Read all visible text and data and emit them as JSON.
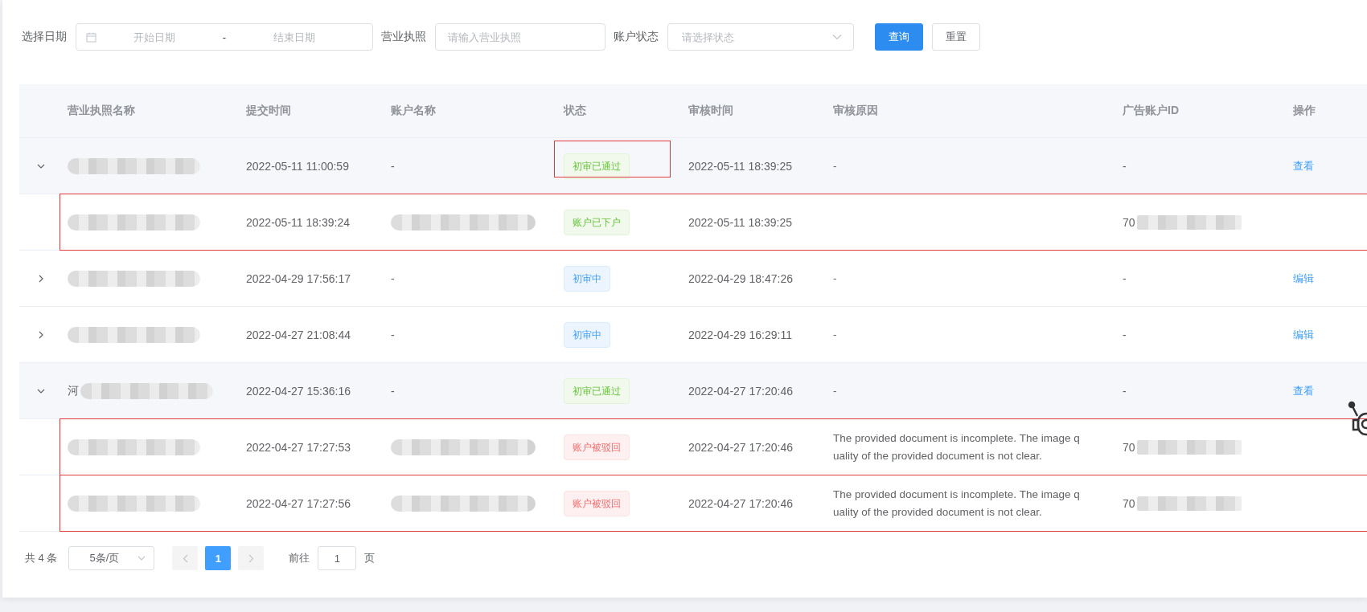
{
  "filters": {
    "date_label": "选择日期",
    "date_start_placeholder": "开始日期",
    "date_separator": "-",
    "date_end_placeholder": "结束日期",
    "license_label": "营业执照",
    "license_placeholder": "请输入营业执照",
    "status_label": "账户状态",
    "status_placeholder": "请选择状态",
    "query_button": "查询",
    "reset_button": "重置"
  },
  "table": {
    "columns": [
      "营业执照名称",
      "提交时间",
      "账户名称",
      "状态",
      "审核时间",
      "审核原因",
      "广告账户ID",
      "操作"
    ],
    "rows": [
      {
        "expanded": true,
        "highlighted": false,
        "status_highlighted": true,
        "name_blurred": true,
        "submitted": "2022-05-11 11:00:59",
        "account": "-",
        "status": {
          "label": "初审已通过",
          "color": "#f0f9eb"
        },
        "reviewed": "2022-05-11 18:39:25",
        "reason": "-",
        "ad_id": "-",
        "action": "查看",
        "children": [
          {
            "highlighted": true,
            "name_blurred": true,
            "submitted": "2022-05-11 18:39:24",
            "account_blurred": true,
            "status": {
              "label": "账户已下户",
              "color": "#f0f9eb"
            },
            "reviewed": "2022-05-11 18:39:25",
            "ad_id": "70",
            "ad_id_blurred": true
          }
        ]
      },
      {
        "expanded": false,
        "highlighted": false,
        "status_highlighted": false,
        "name_blurred": true,
        "submitted": "2022-04-29 17:56:17",
        "account": "-",
        "status": {
          "label": "初审中",
          "color": "#ecf5ff"
        },
        "reviewed": "2022-04-29 18:47:26",
        "reason": "-",
        "ad_id": "-",
        "action": "编辑"
      },
      {
        "expanded": false,
        "highlighted": false,
        "status_highlighted": false,
        "name_blurred": true,
        "submitted": "2022-04-27 21:08:44",
        "account": "-",
        "status": {
          "label": "初审中",
          "color": "#ecf5ff"
        },
        "reviewed": "2022-04-29 16:29:11",
        "reason": "-",
        "ad_id": "-",
        "action": "编辑"
      },
      {
        "expanded": true,
        "highlighted": false,
        "status_highlighted": false,
        "name": "河",
        "name_blurred": true,
        "submitted": "2022-04-27 15:36:16",
        "account": "-",
        "status": {
          "label": "初审已通过",
          "color": "#f0f9eb"
        },
        "reviewed": "2022-04-27 17:20:46",
        "reason": "-",
        "ad_id": "-",
        "action": "查看",
        "children": [
          {
            "highlighted": true,
            "name_blurred": true,
            "submitted": "2022-04-27 17:27:53",
            "account_blurred": true,
            "status": {
              "label": "账户被驳回",
              "color": "#fef0f0"
            },
            "reviewed": "2022-04-27 17:20:46",
            "reason": "The provided document is incomplete. The image q uality of the provided document is not clear.",
            "ad_id": "70",
            "ad_id_blurred": true
          },
          {
            "highlighted": true,
            "name_blurred": true,
            "submitted": "2022-04-27 17:27:56",
            "account_blurred": true,
            "status": {
              "label": "账户被驳回",
              "color": "#fef0f0"
            },
            "reviewed": "2022-04-27 17:20:46",
            "reason": "The provided document is incomplete. The image q uality of the provided document is not clear.",
            "ad_id": "70",
            "ad_id_blurred": true
          }
        ]
      }
    ]
  },
  "pagination": {
    "total": "共 4 条",
    "page_size": "5条/页",
    "pages": [
      {
        "label": "1",
        "selected": true
      }
    ],
    "goto_label": "前往",
    "goto_value": "1",
    "goto_suffix": "页"
  }
}
